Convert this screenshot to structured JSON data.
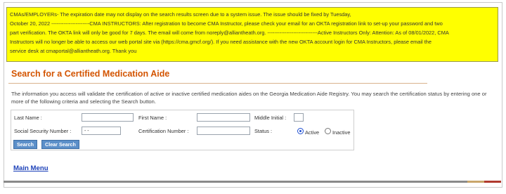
{
  "notice": {
    "line1": "CMAs/EMPLOYERs- The expiration date may not display on the search results screen due to a system issue. The issue should be fixed by Tuesday,",
    "line2": "October 20, 2022 ----------------------CMA INSTRUCTORS: After registration to become CMA Instructor, please check your email for an OKTA registration link to set-up your password and two",
    "line3": "part verification. The OKTA link will only be good for 7 days. The email will come from noreply@alliantheath.org. -----------------------------Active Instructors Only: Attention: As of 08/01/2022, CMA",
    "line4": "Instructors will no longer be able to access our web portal site via (https://cma.gmcf.org/). If you need assistance with the new OKTA account login for CMA Instructors, please email the",
    "line5": "service desk at cmaportal@alliantheath.org. Thank you"
  },
  "page_title": "Search for a Certified Medication Aide",
  "info_text": "The information you access will validate the certification of active or inactive certified medication aides on the Georgia Medication Aide Registry. You may search the certification status by entering one or more of the following criteria and selecting the Search button.",
  "form": {
    "last_name_label": "Last Name :",
    "last_name_value": "",
    "first_name_label": "First Name :",
    "first_name_value": "",
    "middle_initial_label": "Middle Initial :",
    "middle_initial_value": "",
    "ssn_label": "Social Security Number :",
    "ssn_value": "- -",
    "cert_number_label": "Certification Number :",
    "cert_number_value": "",
    "status_label": "Status :",
    "status_active_label": "Active",
    "status_inactive_label": "Inactive",
    "status_selected": "Active",
    "search_button": "Search",
    "clear_button": "Clear Search"
  },
  "main_menu_link": "Main Menu",
  "colors": {
    "notice_bg": "#ffff00",
    "heading": "#d35400",
    "button": "#5b8fc9",
    "link": "#1a3fb8"
  }
}
